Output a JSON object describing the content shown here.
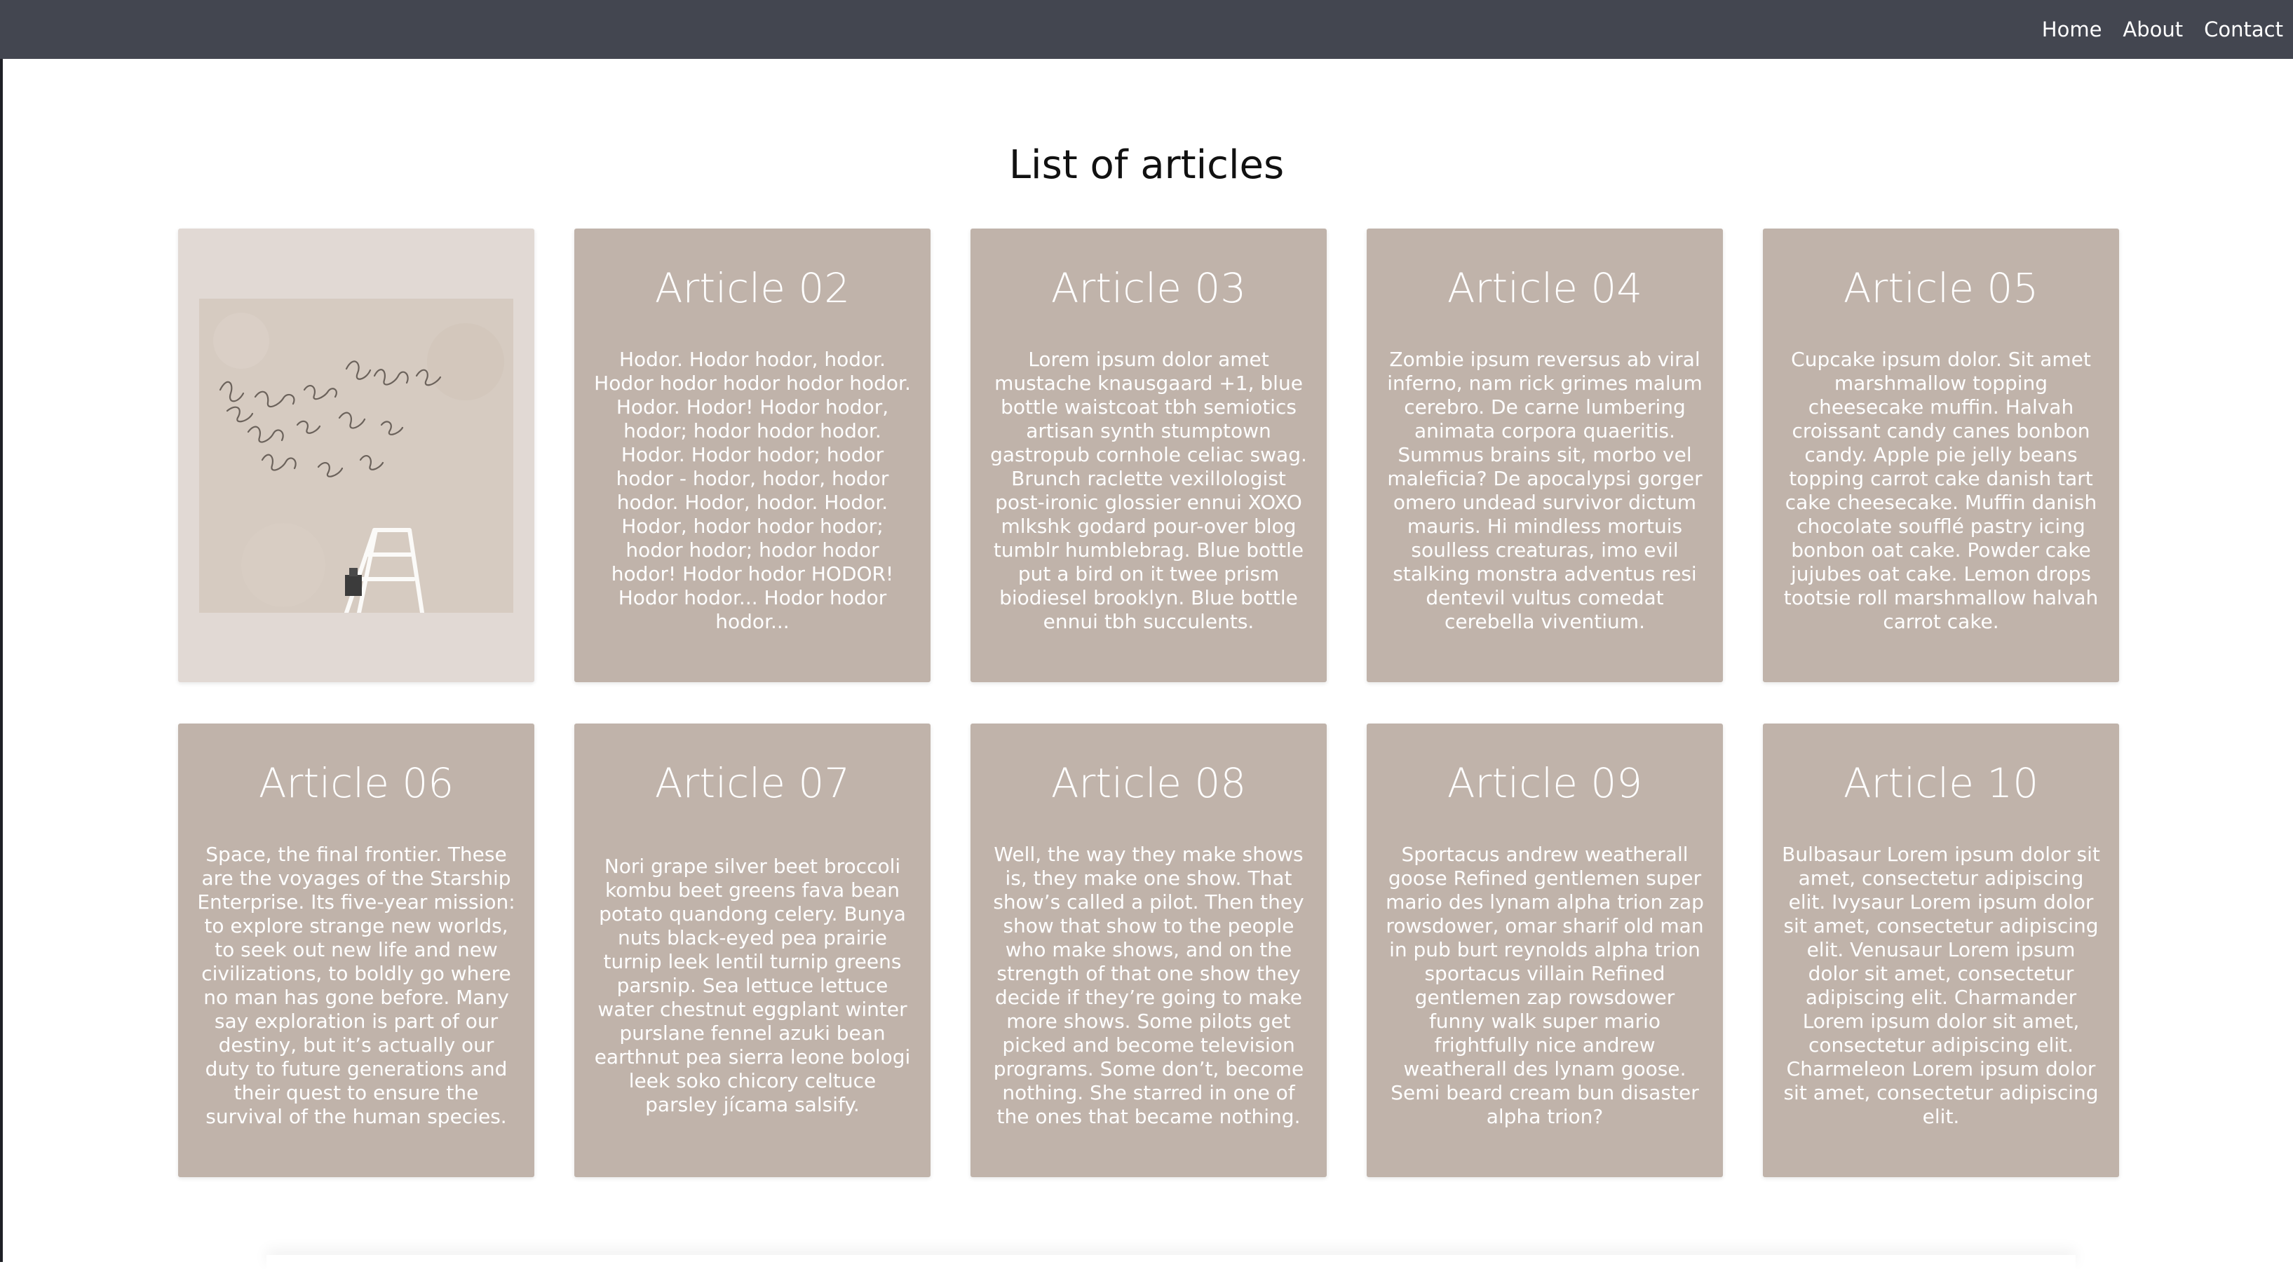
{
  "nav": {
    "home": "Home",
    "about": "About",
    "contact": "Contact"
  },
  "page": {
    "title": "List of articles"
  },
  "articles": [
    {
      "title": "",
      "body": "",
      "image": "ladder-and-handwriting-photo"
    },
    {
      "title": "Article 02",
      "body": "Hodor. Hodor hodor, hodor. Hodor hodor hodor hodor hodor. Hodor. Hodor! Hodor hodor, hodor; hodor hodor hodor. Hodor. Hodor hodor; hodor hodor - hodor, hodor, hodor hodor. Hodor, hodor. Hodor. Hodor, hodor hodor hodor; hodor hodor; hodor hodor hodor! Hodor hodor HODOR! Hodor hodor... Hodor hodor hodor..."
    },
    {
      "title": "Article 03",
      "body": "Lorem ipsum dolor amet mustache knausgaard +1, blue bottle waistcoat tbh semiotics artisan synth stumptown gastropub cornhole celiac swag. Brunch raclette vexillologist post-ironic glossier ennui XOXO mlkshk godard pour-over blog tumblr humblebrag. Blue bottle put a bird on it twee prism biodiesel brooklyn. Blue bottle ennui tbh succulents."
    },
    {
      "title": "Article 04",
      "body": "Zombie ipsum reversus ab viral inferno, nam rick grimes malum cerebro. De carne lumbering animata corpora quaeritis. Summus brains sit, morbo vel maleficia? De apocalypsi gorger omero undead survivor dictum mauris. Hi mindless mortuis soulless creaturas, imo evil stalking monstra adventus resi dentevil vultus comedat cerebella viventium."
    },
    {
      "title": "Article 05",
      "body": "Cupcake ipsum dolor. Sit amet marshmallow topping cheesecake muffin. Halvah croissant candy canes bonbon candy. Apple pie jelly beans topping carrot cake danish tart cake cheesecake. Muffin danish chocolate soufflé pastry icing bonbon oat cake. Powder cake jujubes oat cake. Lemon drops tootsie roll marshmallow halvah carrot cake."
    },
    {
      "title": "Article 06",
      "body": "Space, the final frontier. These are the voyages of the Starship Enterprise. Its five-year mission: to explore strange new worlds, to seek out new life and new civilizations, to boldly go where no man has gone before. Many say exploration is part of our destiny, but it’s actually our duty to future generations and their quest to ensure the survival of the human species."
    },
    {
      "title": "Article 07",
      "body": "Nori grape silver beet broccoli kombu beet greens fava bean potato quandong celery. Bunya nuts black-eyed pea prairie turnip leek lentil turnip greens parsnip. Sea lettuce lettuce water chestnut eggplant winter purslane fennel azuki bean earthnut pea sierra leone bologi leek soko chicory celtuce parsley jícama salsify."
    },
    {
      "title": "Article 08",
      "body": "Well, the way they make shows is, they make one show. That show’s called a pilot. Then they show that show to the people who make shows, and on the strength of that one show they decide if they’re going to make more shows. Some pilots get picked and become television programs. Some don’t, become nothing. She starred in one of the ones that became nothing."
    },
    {
      "title": "Article 09",
      "body": "Sportacus andrew weatherall goose Refined gentlemen super mario des lynam alpha trion zap rowsdower, omar sharif old man in pub burt reynolds alpha trion sportacus villain Refined gentlemen zap rowsdower funny walk super mario frightfully nice andrew weatherall des lynam goose. Semi beard cream bun disaster alpha trion?"
    },
    {
      "title": "Article 10",
      "body": "Bulbasaur Lorem ipsum dolor sit amet, consectetur adipiscing elit. Ivysaur Lorem ipsum dolor sit amet, consectetur adipiscing elit. Venusaur Lorem ipsum dolor sit amet, consectetur adipiscing elit. Charmander Lorem ipsum dolor sit amet, consectetur adipiscing elit. Charmeleon Lorem ipsum dolor sit amet, consectetur adipiscing elit."
    }
  ],
  "colors": {
    "navbar": "#434650",
    "card": "#c0b3aa",
    "image_card": "#e1d9d4"
  }
}
